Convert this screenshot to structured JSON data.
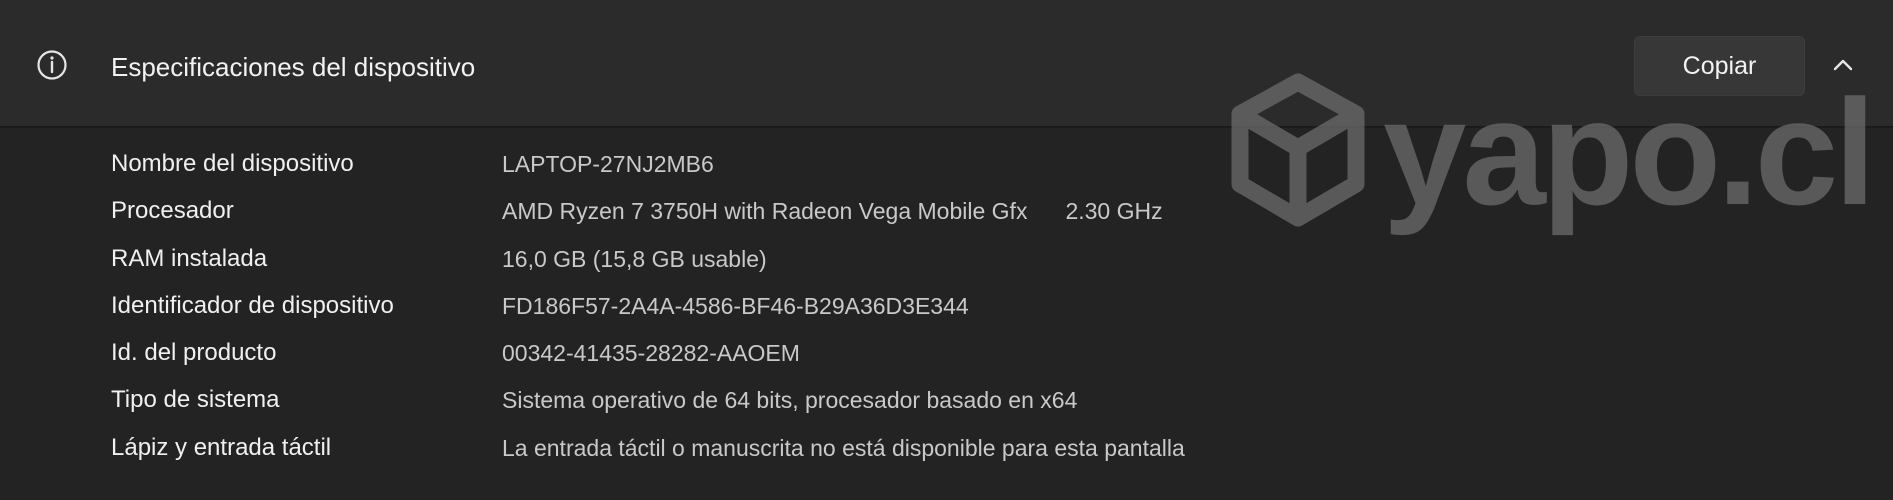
{
  "header": {
    "title": "Especificaciones del dispositivo",
    "icon": "info-icon",
    "copy_label": "Copiar",
    "collapse_icon": "chevron-up-icon"
  },
  "specs": [
    {
      "label": "Nombre del dispositivo",
      "value": "LAPTOP-27NJ2MB6"
    },
    {
      "label": "Procesador",
      "value": "AMD Ryzen 7 3750H with Radeon Vega Mobile Gfx",
      "extra": "2.30 GHz"
    },
    {
      "label": "RAM instalada",
      "value": "16,0 GB (15,8 GB usable)"
    },
    {
      "label": "Identificador de dispositivo",
      "value": "FD186F57-2A4A-4586-BF46-B29A36D3E344"
    },
    {
      "label": "Id. del producto",
      "value": "00342-41435-28282-AAOEM"
    },
    {
      "label": "Tipo de sistema",
      "value": "Sistema operativo de 64 bits, procesador basado en x64"
    },
    {
      "label": "Lápiz y entrada táctil",
      "value": "La entrada táctil o manuscrita no está disponible para esta pantalla"
    }
  ],
  "watermark": {
    "text": "yapo.cl",
    "icon": "box-logo-icon"
  },
  "colors": {
    "background": "#232323",
    "header_background": "#2b2b2b",
    "button_background": "#373737",
    "label_text": "#f0f0f0",
    "value_text": "#c9c9c9",
    "watermark": "#6b6b6b"
  }
}
